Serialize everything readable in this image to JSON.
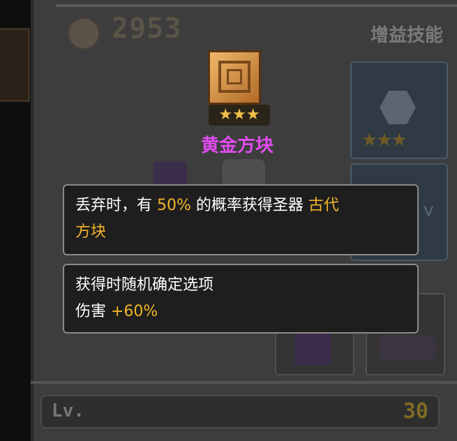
{
  "currency": {
    "icon": "coin-icon",
    "amount": "2953"
  },
  "skills_panel": {
    "title": "增益技能",
    "slot1": {
      "icon": "lightning-shield-icon",
      "stars": "★★★"
    },
    "slot2": {
      "icon": "skill-icon",
      "stars": "★★",
      "mark": "v"
    }
  },
  "item": {
    "icon": "golden-cube-icon",
    "stars": "★★★",
    "name": "黄金方块",
    "name_color": "#e24cf0"
  },
  "tooltip1": {
    "prefix": "丢弃时，有 ",
    "chance": "50%",
    "middle": " 的概率获得圣器 ",
    "relic_line1": "古代",
    "relic_line2": "方块"
  },
  "tooltip2": {
    "line1": "获得时随机确定选项",
    "stat_label": "伤害 ",
    "stat_value": "+60%"
  },
  "level": {
    "label": "Lv.",
    "value": "30"
  },
  "colors": {
    "highlight": "#f2b52a",
    "item_name": "#e24cf0"
  }
}
